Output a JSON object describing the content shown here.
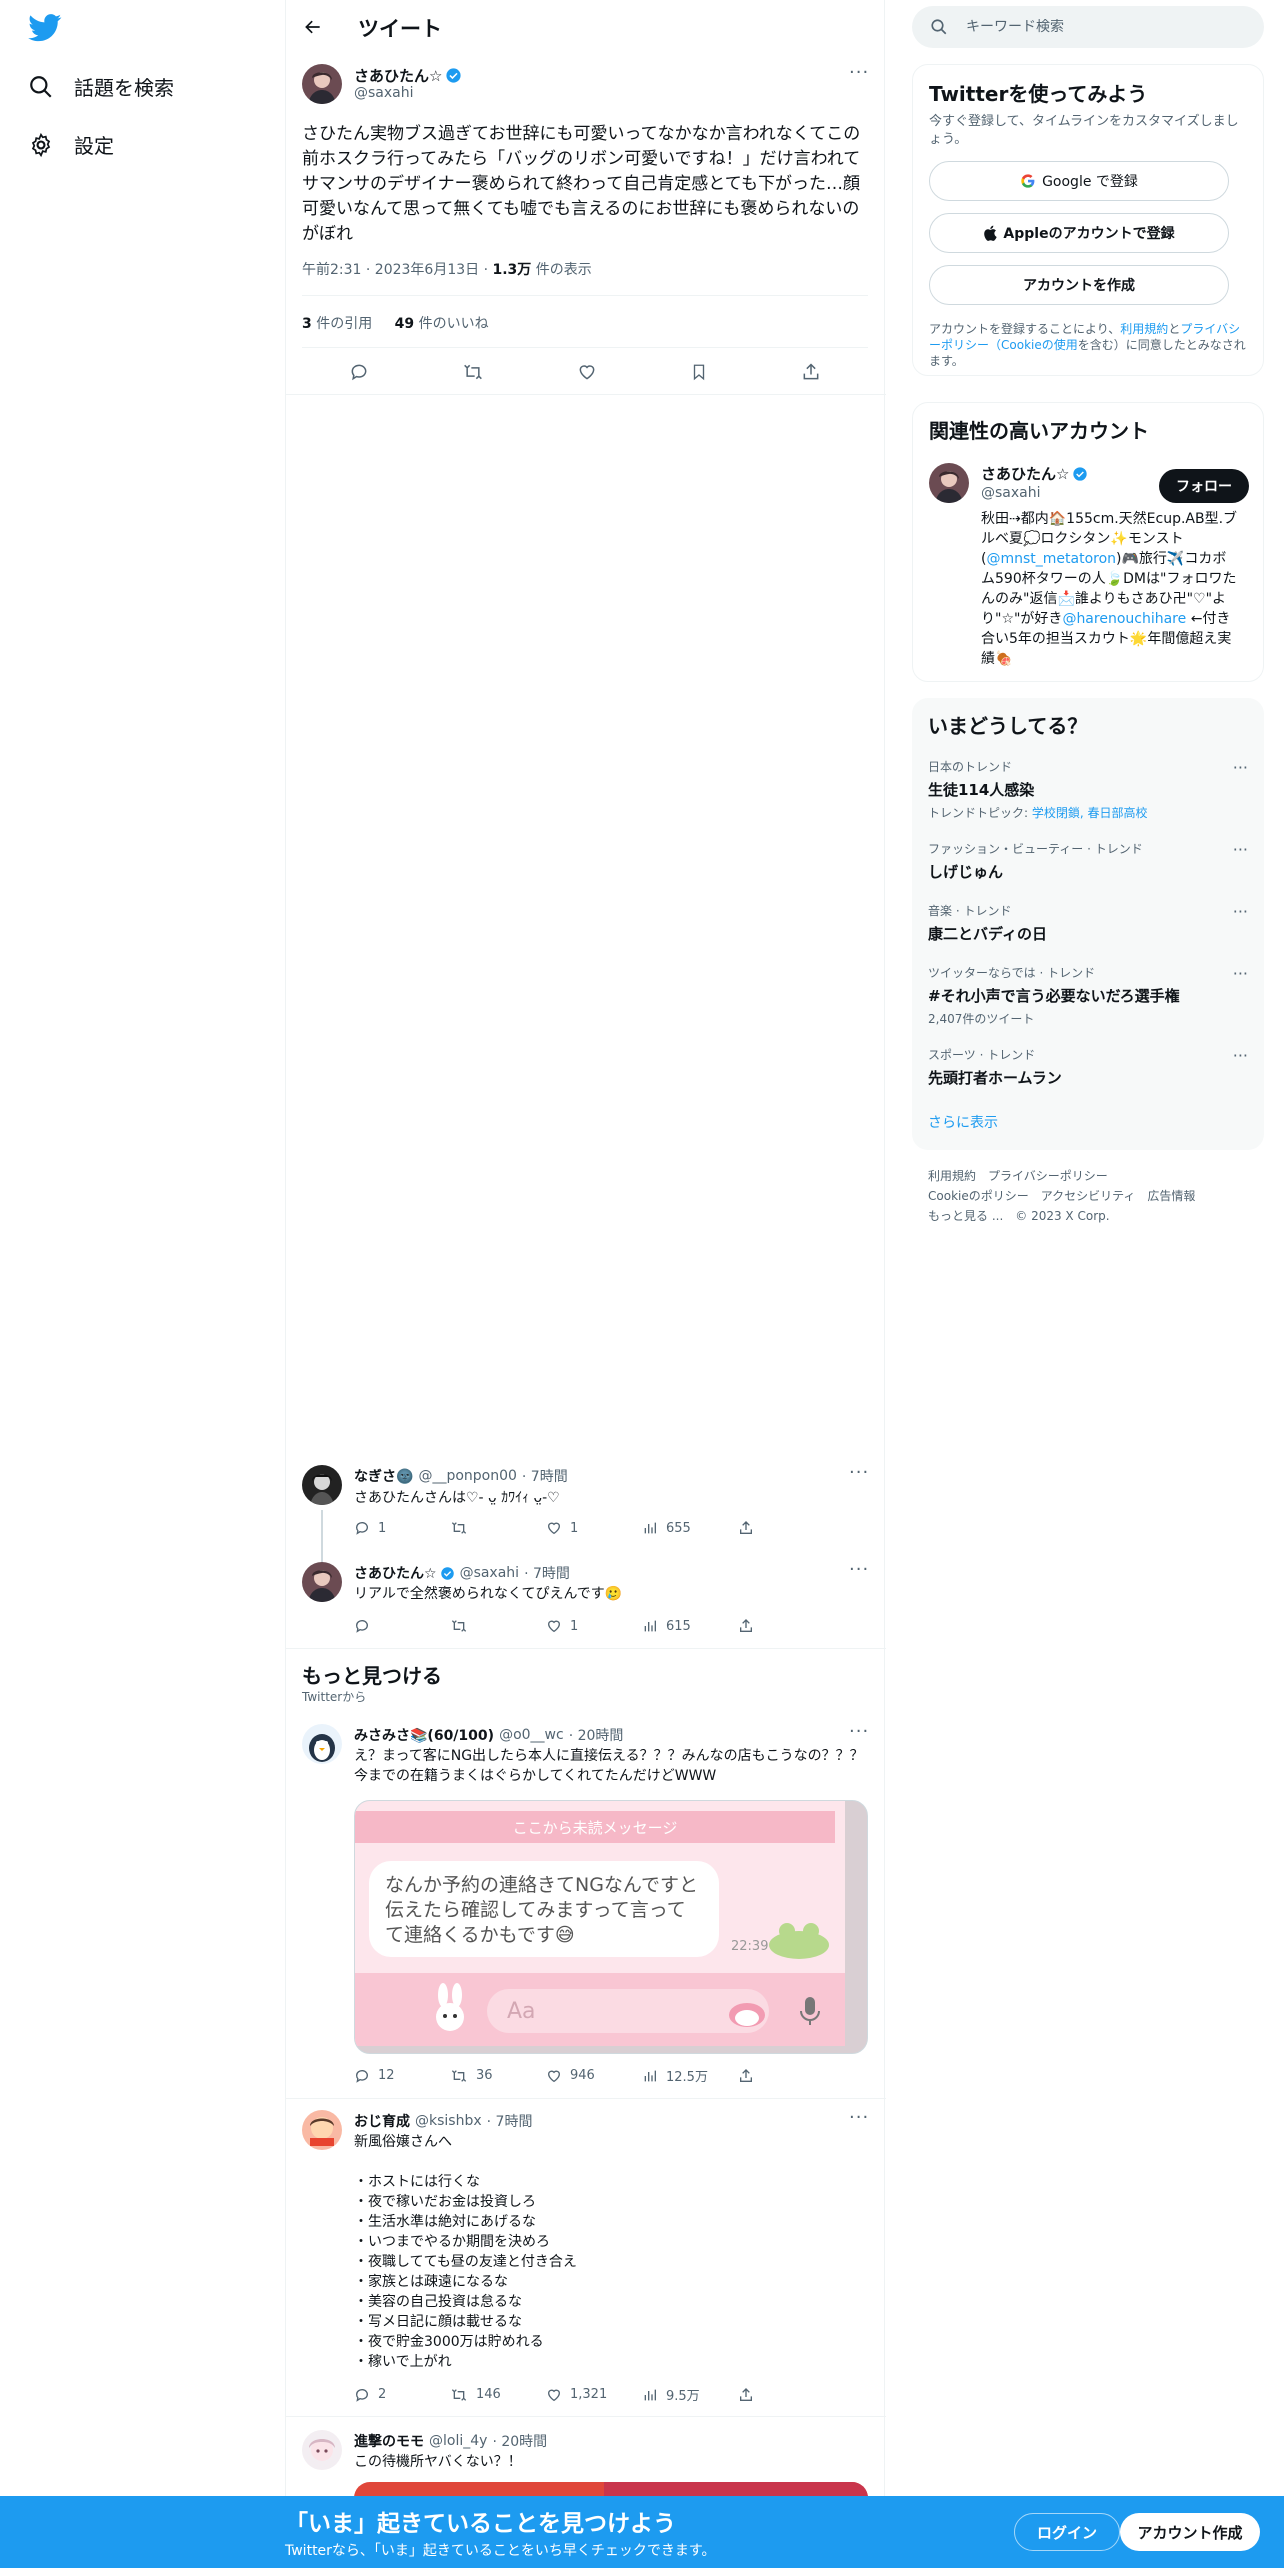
{
  "nav": {
    "explore_label": "話題を検索",
    "settings_label": "設定"
  },
  "header": {
    "title": "ツイート"
  },
  "main_tweet": {
    "author": "さあひたん☆",
    "handle": "@saxahi",
    "text": "さひたん実物ブス過ぎてお世辞にも可愛いってなかなか言われなくてこの前ホスクラ行ってみたら「バッグのリボン可愛いですね！」だけ言われてサマンサのデザイナー褒められて終わって自己肯定感とても下がった…顔可愛いなんて思って無くても嘘でも言えるのにお世辞にも褒められないのがぼれ",
    "time": "午前2:31 · 2023年6月13日 · ",
    "views_count": "1.3万",
    "views_label": " 件の表示",
    "quotes_count": "3",
    "quotes_label": " 件の引用",
    "likes_count": "49",
    "likes_label": " 件のいいね"
  },
  "replies": [
    {
      "author": "なぎさ🌚",
      "handle": "@__ponpon00",
      "time": "· 7時間",
      "text": "さあひたんさんは♡- ᴗ̤ ｶﾜｲｨ ᴗ̤-♡",
      "reply_count": "1",
      "retweet_count": "",
      "like_count": "1",
      "view_count": "655"
    },
    {
      "author": "さあひたん☆",
      "handle": "@saxahi",
      "time": "· 7時間",
      "text": "リアルで全然褒められなくてぴえんです🥲",
      "reply_count": "",
      "retweet_count": "",
      "like_count": "1",
      "view_count": "615"
    }
  ],
  "discover": {
    "title": "もっと見つける",
    "subtitle": "Twitterから"
  },
  "discover_tweets": [
    {
      "author": "みさみさ📚(60/100)",
      "handle": "@o0__wc",
      "time": "· 20時間",
      "text": "え？まって客にNG出したら本人に直接伝える？？？みんなの店もこうなの？？？今までの在籍うまくはぐらかしてくれてたんだけどWWW",
      "image": {
        "header": "ここから未読メッセージ",
        "bubble": "なんか予約の連絡きてNGなんですと伝えたら確認してみますって言ってて連絡くるかもです😅",
        "time": "22:39",
        "input_placeholder": "Aa"
      },
      "reply_count": "12",
      "retweet_count": "36",
      "like_count": "946",
      "view_count": "12.5万"
    },
    {
      "author": "おじ育成",
      "handle": "@ksishbx",
      "time": "· 7時間",
      "lines": [
        "新風俗嬢さんへ",
        "",
        "・ホストには行くな",
        "・夜で稼いだお金は投資しろ",
        "・生活水準は絶対にあげるな",
        "・いつまでやるか期間を決めろ",
        "・夜職してても昼の友達と付き合え",
        "・家族とは疎遠になるな",
        "・美容の自己投資は怠るな",
        "・写メ日記に顔は載せるな",
        "・夜で貯金3000万は貯めれる",
        "・稼いで上がれ"
      ],
      "reply_count": "2",
      "retweet_count": "146",
      "like_count": "1,321",
      "view_count": "9.5万"
    },
    {
      "author": "進撃のモモ",
      "handle": "@loli_4y",
      "time": "· 20時間",
      "text": "この待機所ヤバくない？！"
    }
  ],
  "search": {
    "placeholder": "キーワード検索"
  },
  "signup_card": {
    "title": "Twitterを使ってみよう",
    "subtitle": "今すぐ登録して、タイムラインをカスタマイズしましょう。",
    "google_label": "Google で登録",
    "apple_label": "Appleのアカウントで登録",
    "create_label": "アカウントを作成",
    "legal_prefix": "アカウントを登録することにより、",
    "legal_terms": "利用規約",
    "legal_and": "と",
    "legal_privacy": "プライバシーポリシー",
    "legal_paren_open": "（",
    "legal_cookie": "Cookieの使用",
    "legal_suffix": "を含む）に同意したとみなされます。"
  },
  "related": {
    "title": "関連性の高いアカウント",
    "name": "さあひたん☆",
    "handle": "@saxahi",
    "follow_label": "フォロー",
    "bio_1": "秋田⇢都内🏠155cm.天然Ecup.AB型.ブルベ夏💭ロクシタン✨モンスト(",
    "bio_link_1": "@mnst_metatoron",
    "bio_2": ")🎮旅行✈️コカボム590杯タワーの人🍃DMは\"フォロワたんのみ\"返信📩誰よりもさあひ卍\"♡\"より\"☆\"が好き",
    "bio_link_2": "@harenouchihare",
    "bio_3": " ←付き合い5年の担当スカウト🌟年間億超え実績🍖"
  },
  "trends": {
    "title": "いまどうしてる？",
    "items": [
      {
        "context": "日本のトレンド",
        "name": "生徒114人感染",
        "extra_prefix": "トレンドトピック: ",
        "extra_link": "学校閉鎖, 春日部高校"
      },
      {
        "context": "ファッション・ビューティー · トレンド",
        "name": "しげじゅん"
      },
      {
        "context": "音楽 · トレンド",
        "name": "康二とバディの日"
      },
      {
        "context": "ツイッターならでは · トレンド",
        "name": "#それ小声で言う必要ないだろ選手権",
        "extra": "2,407件のツイート"
      },
      {
        "context": "スポーツ · トレンド",
        "name": "先頭打者ホームラン"
      }
    ],
    "show_more": "さらに表示"
  },
  "footer": {
    "links": [
      "利用規約",
      "プライバシーポリシー",
      "Cookieのポリシー",
      "アクセシビリティ",
      "広告情報",
      "もっと見る ..."
    ],
    "copyright": "© 2023 X Corp."
  },
  "banner": {
    "title": "「いま」起きていることを見つけよう",
    "subtitle": "Twitterなら、「いま」起きていることをいち早くチェックできます。",
    "login_label": "ログイン",
    "signup_label": "アカウント作成"
  },
  "colors": {
    "accent": "#1d9bf0",
    "text": "#0f1419",
    "secondary": "#536471"
  }
}
